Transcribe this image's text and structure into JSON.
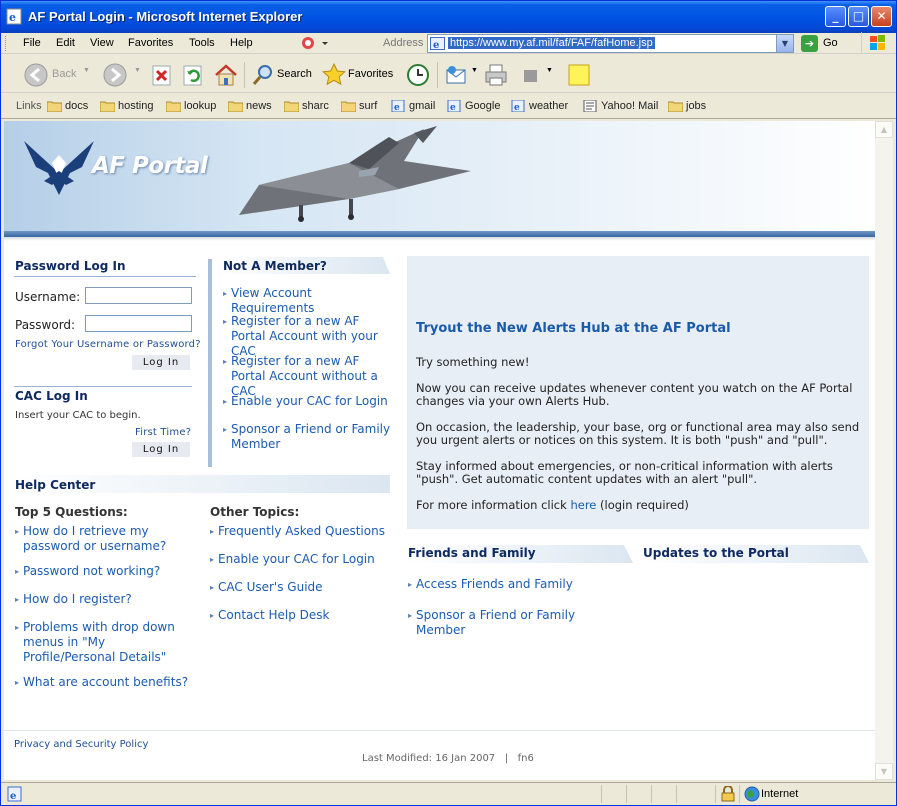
{
  "window": {
    "title": "AF Portal Login - Microsoft Internet Explorer",
    "colors": {
      "titlebar": "#0054e3",
      "chrome": "#ece9d8"
    }
  },
  "menubar": {
    "items": [
      "File",
      "Edit",
      "View",
      "Favorites",
      "Tools",
      "Help"
    ]
  },
  "address": {
    "label": "Address",
    "url": "https://www.my.af.mil/faf/FAF/fafHome.jsp",
    "go_label": "Go"
  },
  "toolbar": {
    "back_label": "Back",
    "search_label": "Search",
    "favorites_label": "Favorites"
  },
  "links_bar": {
    "title": "Links",
    "items": [
      {
        "label": "docs",
        "icon": "folder-icon"
      },
      {
        "label": "hosting",
        "icon": "folder-icon"
      },
      {
        "label": "lookup",
        "icon": "folder-icon"
      },
      {
        "label": "news",
        "icon": "folder-icon"
      },
      {
        "label": "sharc",
        "icon": "folder-icon"
      },
      {
        "label": "surf",
        "icon": "folder-icon"
      },
      {
        "label": "gmail",
        "icon": "ie-page-icon"
      },
      {
        "label": "Google",
        "icon": "ie-page-icon"
      },
      {
        "label": "weather",
        "icon": "ie-page-icon"
      },
      {
        "label": "Yahoo! Mail",
        "icon": "mail-page-icon"
      },
      {
        "label": "jobs",
        "icon": "folder-icon"
      }
    ]
  },
  "banner": {
    "brand": "AF Portal"
  },
  "password_login": {
    "title": "Password Log In",
    "username_label": "Username:",
    "password_label": "Password:",
    "forgot_link": "Forgot Your Username or Password?",
    "login_button": "Log In"
  },
  "cac_login": {
    "title": "CAC Log In",
    "instruction": "Insert your CAC to begin.",
    "first_time_link": "First Time?",
    "login_button": "Log In"
  },
  "not_member": {
    "title": "Not A Member?",
    "links": [
      "View Account Requirements",
      "Register for a new AF Portal Account with your CAC",
      "Register for a new AF Portal Account without a CAC",
      "Enable your CAC for Login",
      "Sponsor a Friend or Family Member"
    ]
  },
  "help_center": {
    "title": "Help Center",
    "top5_title": "Top 5 Questions:",
    "top5": [
      "How do I retrieve my password or username?",
      "Password not working?",
      "How do I register?",
      "Problems with drop down menus in \"My Profile/Personal Details\"",
      "What are account benefits?"
    ],
    "other_title": "Other Topics:",
    "other": [
      "Frequently Asked Questions",
      "Enable your CAC for Login",
      "CAC User's Guide",
      "Contact Help Desk"
    ]
  },
  "promo": {
    "title": "Tryout the New Alerts Hub at the AF Portal",
    "p1": "Try something new!",
    "p2": "Now you can receive updates whenever content you watch on the AF Portal changes via your own Alerts Hub.",
    "p3": "On occasion, the leadership, your base, org or functional area may also send you urgent alerts or notices on this system. It is both \"push\" and \"pull\".",
    "p4": "Stay informed about emergencies, or non-critical information with alerts \"push\". Get automatic content updates with an alert \"pull\".",
    "p5_prefix": "For more information click ",
    "p5_link": "here",
    "p5_suffix": " (login required)"
  },
  "friends_family": {
    "title": "Friends and Family",
    "links": [
      "Access Friends and Family",
      "Sponsor a Friend or Family Member"
    ]
  },
  "updates": {
    "title": "Updates to the Portal"
  },
  "footer": {
    "privacy_link": "Privacy and Security Policy",
    "last_modified": "Last Modified: 16 Jan 2007   |   fn6"
  },
  "statusbar": {
    "zone": "Internet"
  }
}
